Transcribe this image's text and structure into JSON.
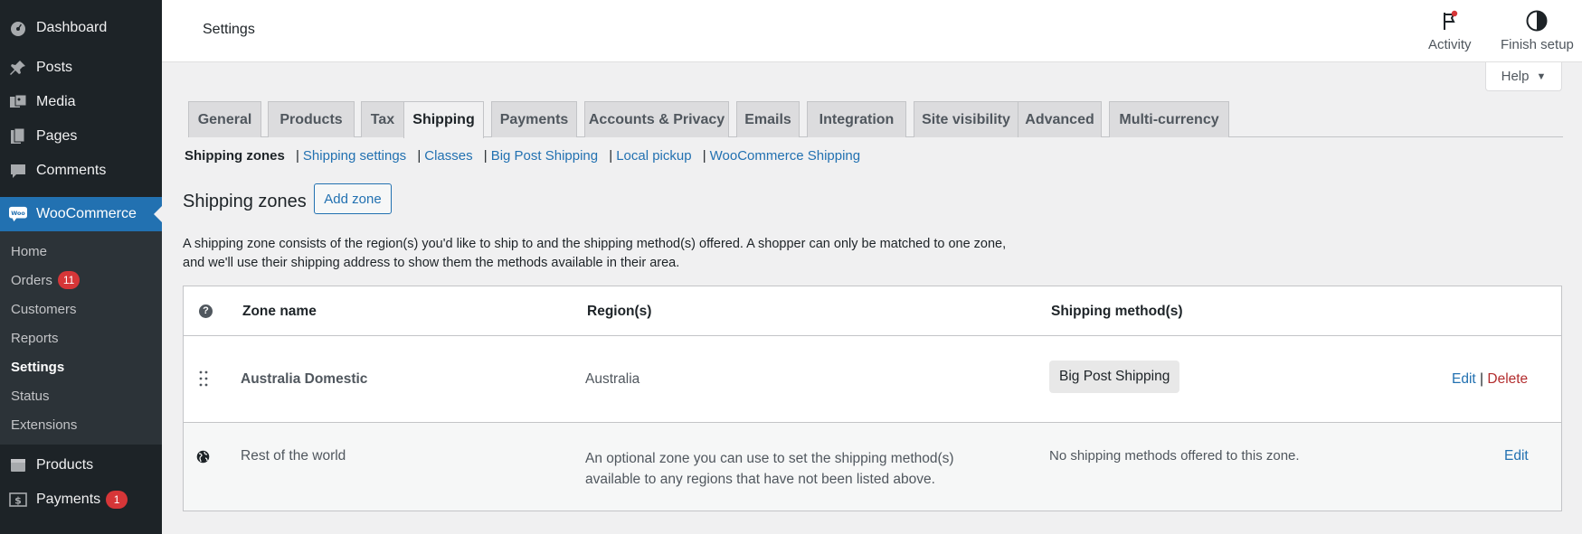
{
  "sidebar": {
    "items": [
      {
        "label": "Dashboard",
        "icon": "dashboard-icon"
      },
      {
        "label": "Posts",
        "icon": "pin-icon"
      },
      {
        "label": "Media",
        "icon": "media-icon"
      },
      {
        "label": "Pages",
        "icon": "pages-icon"
      },
      {
        "label": "Comments",
        "icon": "comment-icon"
      },
      {
        "label": "WooCommerce",
        "icon": "woo-icon"
      }
    ],
    "submenu": [
      {
        "label": "Home"
      },
      {
        "label": "Orders",
        "badge": "11"
      },
      {
        "label": "Customers"
      },
      {
        "label": "Reports"
      },
      {
        "label": "Settings"
      },
      {
        "label": "Status"
      },
      {
        "label": "Extensions"
      }
    ],
    "bottom": [
      {
        "label": "Products",
        "icon": "products-icon"
      },
      {
        "label": "Payments",
        "icon": "payments-icon",
        "badge": "1"
      }
    ]
  },
  "header": {
    "title": "Settings",
    "activity_label": "Activity",
    "finish_setup_label": "Finish setup",
    "help_label": "Help"
  },
  "tabs": [
    "General",
    "Products",
    "Tax",
    "Shipping",
    "Payments",
    "Accounts & Privacy",
    "Emails",
    "Integration",
    "Site visibility",
    "Advanced",
    "Multi-currency"
  ],
  "active_tab": "Shipping",
  "sublinks": {
    "current": "Shipping zones",
    "links": [
      "Shipping settings",
      "Classes",
      "Big Post Shipping",
      "Local pickup",
      "WooCommerce Shipping"
    ]
  },
  "zones": {
    "heading": "Shipping zones",
    "add_label": "Add zone",
    "intro": "A shipping zone consists of the region(s) you'd like to ship to and the shipping method(s) offered. A shopper can only be matched to one zone, and we'll use their shipping address to show them the methods available in their area.",
    "columns": {
      "name": "Zone name",
      "regions": "Region(s)",
      "methods": "Shipping method(s)",
      "help": "?"
    },
    "rows": [
      {
        "name": "Australia Domestic",
        "region": "Australia",
        "method": "Big Post Shipping",
        "edit": "Edit",
        "sep": "|",
        "delete": "Delete"
      },
      {
        "name": "Rest of the world",
        "region": "An optional zone you can use to set the shipping method(s) available to any regions that have not been listed above.",
        "method": "No shipping methods offered to this zone.",
        "edit": "Edit"
      }
    ]
  },
  "colors": {
    "sidebar_bg": "#1d2327",
    "accent": "#2271b1",
    "badge": "#d63638",
    "delete": "#b32d2e"
  }
}
